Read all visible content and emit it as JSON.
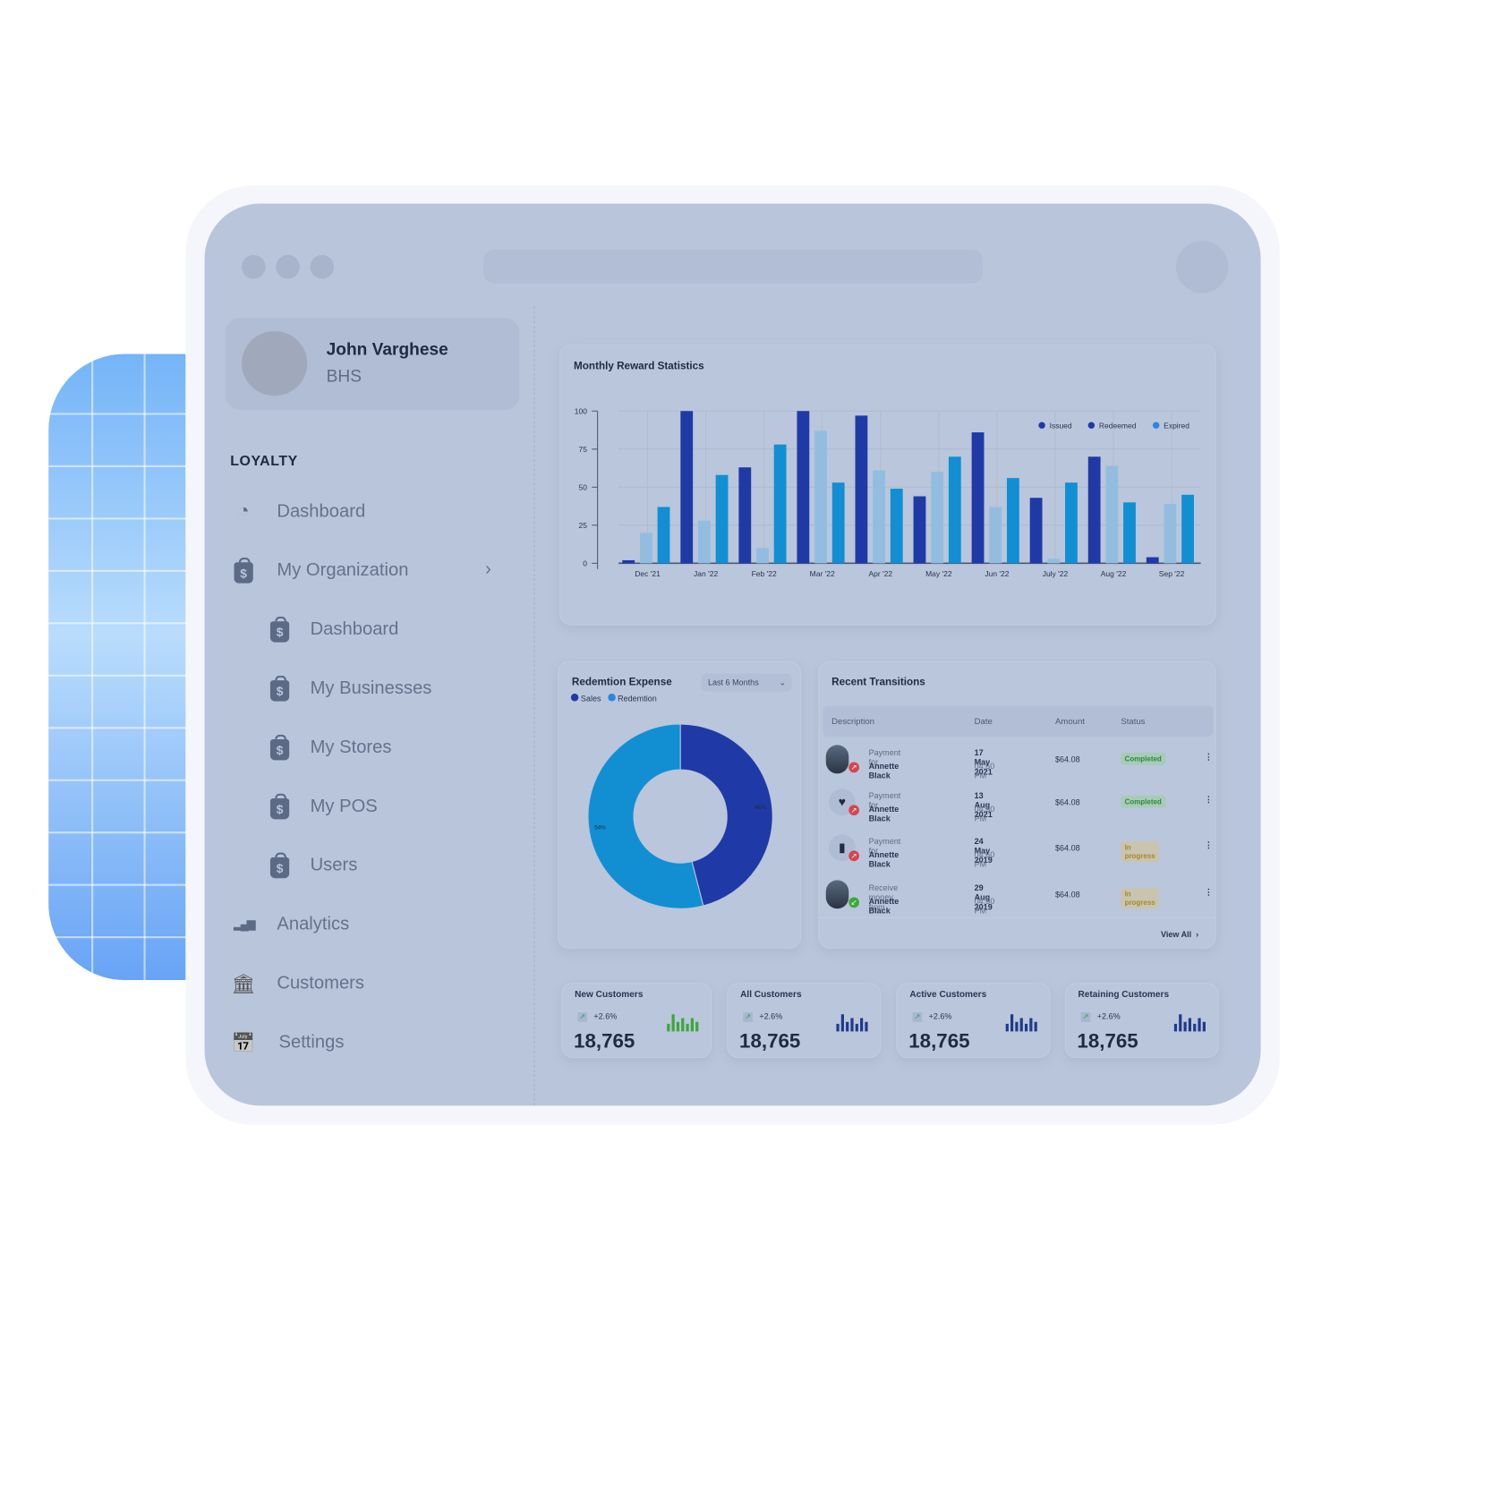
{
  "profile": {
    "name": "John Varghese",
    "org": "BHS"
  },
  "sidebar": {
    "section": "LOYALTY",
    "items": [
      {
        "label": "Dashboard",
        "icon": "gauge-icon"
      },
      {
        "label": "My Organization",
        "icon": "shopping-bag-dollar-icon",
        "chevron": "›"
      },
      {
        "label": "Dashboard",
        "icon": "shopping-bag-dollar-icon"
      },
      {
        "label": "My Businesses",
        "icon": "shopping-bag-dollar-icon"
      },
      {
        "label": "My Stores",
        "icon": "shopping-bag-dollar-icon"
      },
      {
        "label": "My POS",
        "icon": "shopping-bag-dollar-icon"
      },
      {
        "label": "Users",
        "icon": "shopping-bag-dollar-icon"
      },
      {
        "label": "Analytics",
        "icon": "analytics-icon"
      },
      {
        "label": "Customers",
        "icon": "bank-icon"
      },
      {
        "label": "Settings",
        "icon": "calendar-check-icon"
      }
    ]
  },
  "colors": {
    "issued": "#1f3aa6",
    "redeemed": "#93bde0",
    "expired": "#118fd2",
    "legend_expired": "#2a86e0",
    "sales": "#1f3aa6",
    "redemtion": "#118fd2"
  },
  "chart_data": [
    {
      "type": "bar",
      "title": "Monthly Reward Statistics",
      "categories": [
        "Dec '21",
        "Jan '22",
        "Feb '22",
        "Mar '22",
        "Apr '22",
        "May '22",
        "Jun '22",
        "July '22",
        "Aug '22",
        "Sep '22"
      ],
      "yticks": [
        "0",
        "25",
        "50",
        "75",
        "100"
      ],
      "ylim": [
        0,
        100
      ],
      "grid": true,
      "legend_position": "top-right",
      "series": [
        {
          "name": "Issued",
          "values": [
            2,
            100,
            63,
            100,
            97,
            44,
            86,
            43,
            70,
            4
          ]
        },
        {
          "name": "Redeemed",
          "values": [
            20,
            28,
            10,
            87,
            61,
            60,
            37,
            3,
            64,
            39
          ]
        },
        {
          "name": "Expired",
          "values": [
            37,
            58,
            78,
            53,
            49,
            70,
            56,
            53,
            40,
            45
          ]
        }
      ]
    },
    {
      "type": "pie",
      "title": "Redemtion Expense",
      "filter": "Last 6 Months",
      "slices": [
        {
          "name": "Sales",
          "value": 46,
          "label": "46%"
        },
        {
          "name": "Redemtion",
          "value": 54,
          "label": "54%"
        }
      ]
    }
  ],
  "transactions": {
    "title": "Recent Transitions",
    "columns": [
      "Description",
      "Date",
      "Amount",
      "Status"
    ],
    "rows": [
      {
        "desc": "Payment for",
        "who": "Annette Black",
        "date": "17 May 2021",
        "time": "04:50 PM",
        "amount": "$64.08",
        "status": "Completed",
        "avatar": "person-photo",
        "direction": "outgoing"
      },
      {
        "desc": "Payment for",
        "who": "Annette Black",
        "date": "13 Aug 2021",
        "time": "04:50 PM",
        "amount": "$64.08",
        "status": "Completed",
        "avatar": "heart-icon",
        "direction": "outgoing"
      },
      {
        "desc": "Payment for",
        "who": "Annette Black",
        "date": "24 May 2019",
        "time": "04:50 PM",
        "amount": "$64.08",
        "status": "In progress",
        "avatar": "book-icon",
        "direction": "outgoing"
      },
      {
        "desc": "Receive money from",
        "who": "Annette Black",
        "date": "29 Aug 2019",
        "time": "04:50 PM",
        "amount": "$64.08",
        "status": "In progress",
        "avatar": "person-photo",
        "direction": "incoming"
      }
    ],
    "view_all": "View All"
  },
  "stats": [
    {
      "title": "New Customers",
      "change": "+2.6%",
      "value": "18,765",
      "spark_color": "#3aa83a"
    },
    {
      "title": "All Customers",
      "change": "+2.6%",
      "value": "18,765",
      "spark_color": "#1f3a8a"
    },
    {
      "title": "Active Customers",
      "change": "+2.6%",
      "value": "18,765",
      "spark_color": "#1f3a8a"
    },
    {
      "title": "Retaining Customers",
      "change": "+2.6%",
      "value": "18,765",
      "spark_color": "#1f3a8a"
    }
  ]
}
